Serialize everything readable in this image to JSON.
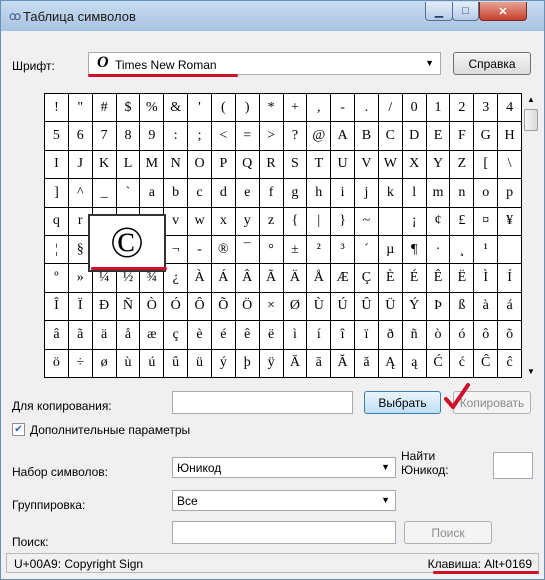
{
  "window": {
    "title": "Таблица символов"
  },
  "font": {
    "label": "Шрифт:",
    "sample_glyph": "O",
    "value": "Times New Roman"
  },
  "help_button": "Справка",
  "grid": {
    "rows": [
      [
        "!",
        "\"",
        "#",
        "$",
        "%",
        "&",
        "'",
        "(",
        ")",
        "*",
        "+",
        ",",
        "-",
        ".",
        "/",
        "0",
        "1",
        "2",
        "3",
        "4"
      ],
      [
        "5",
        "6",
        "7",
        "8",
        "9",
        ":",
        ";",
        "<",
        "=",
        ">",
        "?",
        "@",
        "A",
        "B",
        "C",
        "D",
        "E",
        "F",
        "G",
        "H"
      ],
      [
        "I",
        "J",
        "K",
        "L",
        "M",
        "N",
        "O",
        "P",
        "Q",
        "R",
        "S",
        "T",
        "U",
        "V",
        "W",
        "X",
        "Y",
        "Z",
        "[",
        "\\"
      ],
      [
        "]",
        "^",
        "_",
        "`",
        "a",
        "b",
        "c",
        "d",
        "e",
        "f",
        "g",
        "h",
        "i",
        "j",
        "k",
        "l",
        "m",
        "n",
        "o",
        "p"
      ],
      [
        "q",
        "r",
        "s",
        "t",
        "u",
        "v",
        "w",
        "x",
        "y",
        "z",
        "{",
        "|",
        "}",
        "~",
        " ",
        "¡",
        "¢",
        "£",
        "¤",
        "¥"
      ],
      [
        "¦",
        "§",
        "¨",
        "©",
        "«",
        "¬",
        "-",
        "®",
        "¯",
        "°",
        "±",
        "²",
        "³",
        "´",
        "µ",
        "¶",
        "·",
        "¸",
        "¹",
        ""
      ],
      [
        "º",
        "»",
        "¼",
        "½",
        "¾",
        "¿",
        "À",
        "Á",
        "Â",
        "Ã",
        "Ä",
        "Å",
        "Æ",
        "Ç",
        "È",
        "É",
        "Ê",
        "Ë",
        "Ì",
        "Í"
      ],
      [
        "Î",
        "Ï",
        "Ð",
        "Ñ",
        "Ò",
        "Ó",
        "Ô",
        "Õ",
        "Ö",
        "×",
        "Ø",
        "Ù",
        "Ú",
        "Û",
        "Ü",
        "Ý",
        "Þ",
        "ß",
        "à",
        "á"
      ],
      [
        "â",
        "ã",
        "ä",
        "å",
        "æ",
        "ç",
        "è",
        "é",
        "ê",
        "ë",
        "ì",
        "í",
        "î",
        "ï",
        "ð",
        "ñ",
        "ò",
        "ó",
        "ô",
        "õ"
      ],
      [
        "ö",
        "÷",
        "ø",
        "ù",
        "ú",
        "û",
        "ü",
        "ý",
        "þ",
        "ÿ",
        "Ā",
        "ā",
        "Ă",
        "ă",
        "Ą",
        "ą",
        "Ć",
        "ć",
        "Ĉ",
        "ĉ"
      ]
    ]
  },
  "zoom_glyph": "©",
  "copy": {
    "label": "Для копирования:",
    "value": "",
    "select_button": "Выбрать",
    "copy_button": "Копировать"
  },
  "advanced": {
    "label": "Дополнительные параметры",
    "checked": true
  },
  "charset": {
    "label": "Набор символов:",
    "value": "Юникод"
  },
  "grouping": {
    "label": "Группировка:",
    "value": "Все"
  },
  "find_unicode": {
    "label": "Найти Юникод:",
    "value": ""
  },
  "search": {
    "label": "Поиск:",
    "value": "",
    "button": "Поиск"
  },
  "status": {
    "char_info": "U+00A9: Copyright Sign",
    "key_info": "Клавиша: Alt+0169"
  },
  "colors": {
    "annotation": "#d0102a"
  }
}
